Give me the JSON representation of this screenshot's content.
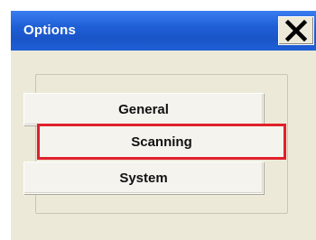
{
  "window": {
    "title": "Options",
    "close_icon": "close-x-icon",
    "accent_color": "#1f5fd6",
    "highlight_color": "#e0202a"
  },
  "options": {
    "buttons": [
      {
        "label": "General"
      },
      {
        "label": "Scanning",
        "highlighted": true
      },
      {
        "label": "System"
      }
    ]
  }
}
